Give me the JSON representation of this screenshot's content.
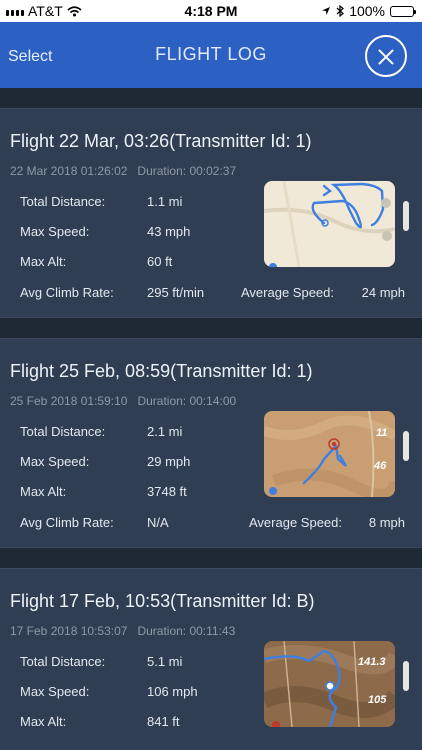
{
  "status_bar": {
    "carrier": "AT&T",
    "time": "4:18 PM",
    "battery": "100%"
  },
  "nav": {
    "select_label": "Select",
    "title": "FLIGHT LOG"
  },
  "flights": [
    {
      "title": "Flight 22 Mar, 03:26(Transmitter Id: 1)",
      "datetime": "22 Mar 2018 01:26:02",
      "duration": "Duration: 00:02:37",
      "total_distance_label": "Total Distance:",
      "total_distance": "1.1 mi",
      "max_speed_label": "Max Speed:",
      "max_speed": "43 mph",
      "max_alt_label": "Max Alt:",
      "max_alt": "60 ft",
      "avg_climb_label": "Avg Climb Rate:",
      "avg_climb": "295 ft/min",
      "avg_speed_label": "Average Speed:",
      "avg_speed": "24 mph"
    },
    {
      "title": "Flight 25 Feb, 08:59(Transmitter Id: 1)",
      "datetime": "25 Feb 2018 01:59:10",
      "duration": "Duration: 00:14:00",
      "total_distance_label": "Total Distance:",
      "total_distance": "2.1 mi",
      "max_speed_label": "Max Speed:",
      "max_speed": "29 mph",
      "max_alt_label": "Max Alt:",
      "max_alt": "3748 ft",
      "avg_climb_label": "Avg Climb Rate:",
      "avg_climb": "N/A",
      "avg_speed_label": "Average Speed:",
      "avg_speed": "8 mph",
      "map_labels": [
        "11",
        "46"
      ]
    },
    {
      "title": "Flight 17 Feb, 10:53(Transmitter Id: B)",
      "datetime": "17 Feb 2018 10:53:07",
      "duration": "Duration: 00:11:43",
      "total_distance_label": "Total Distance:",
      "total_distance": "5.1 mi",
      "max_speed_label": "Max Speed:",
      "max_speed": "106 mph",
      "max_alt_label": "Max Alt:",
      "max_alt": "841 ft",
      "map_labels": [
        "141.3",
        "105"
      ]
    }
  ],
  "colors": {
    "nav_bar": "#2d60c3",
    "card": "#2f3e52",
    "background": "#1f2935",
    "flight_path": "#3e7fe0"
  }
}
